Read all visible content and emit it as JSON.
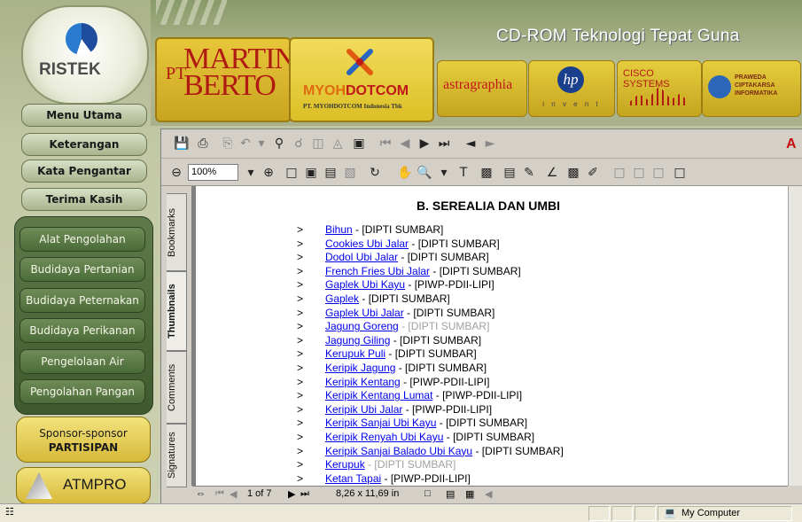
{
  "banner": {
    "title": "CD-ROM Teknologi Tepat Guna",
    "ristek": "RISTEK",
    "logos": {
      "martina_pt": "PT",
      "martina_name": "MARTINA BERTO",
      "myoh_brand_a": "MYOH",
      "myoh_brand_b": "DOTCOM",
      "myoh_sub": "PT. MYOHDOTCOM Indonesia Tbk",
      "astra": "astragraphia",
      "hp_mark": "hp",
      "hp_sub": "i n v e n t",
      "cisco": "CISCO SYSTEMS",
      "praweda": "PRAWEDA CIPTAKARSA INFORMATIKA"
    }
  },
  "nav_top": [
    "Menu Utama",
    "Keterangan",
    "Kata Pengantar",
    "Terima Kasih"
  ],
  "nav_main": [
    "Alat Pengolahan",
    "Budidaya Pertanian",
    "Budidaya Peternakan",
    "Budidaya Perikanan",
    "Pengelolaan Air",
    "Pengolahan Pangan"
  ],
  "sponsor": {
    "line1": "Sponsor-sponsor",
    "line2": "PARTISIPAN"
  },
  "atmpro": "ATMPRO",
  "viewer": {
    "zoom": "100%",
    "tabs": [
      "Bookmarks",
      "Thumbnails",
      "Comments",
      "Signatures"
    ],
    "active_tab": "Thumbnails",
    "page_indicator": "1 of 7",
    "page_size": "8,26 x 11,69 in"
  },
  "document": {
    "heading": "B.   SEREALIA DAN UMBI",
    "items": [
      {
        "title": "Bihun",
        "source": " - [DIPTI SUMBAR]",
        "grey": false
      },
      {
        "title": "Cookies Ubi Jalar",
        "source": " - [DIPTI SUMBAR]",
        "grey": false
      },
      {
        "title": "Dodol Ubi Jalar",
        "source": " - [DIPTI SUMBAR]",
        "grey": false
      },
      {
        "title": "French Fries Ubi Jalar",
        "source": " - [DIPTI SUMBAR]",
        "grey": false
      },
      {
        "title": "Gaplek Ubi Kayu",
        "source": " - [PIWP-PDII-LIPI]",
        "grey": false
      },
      {
        "title": "Gaplek",
        "source": " - [DIPTI SUMBAR]",
        "grey": false
      },
      {
        "title": "Gaplek Ubi Jalar",
        "source": " - [DIPTI SUMBAR]",
        "grey": false
      },
      {
        "title": "Jagung Goreng",
        "source": " - [DIPTI SUMBAR]",
        "grey": true
      },
      {
        "title": "Jagung Giling",
        "source": " - [DIPTI SUMBAR]",
        "grey": false
      },
      {
        "title": "Kerupuk Puli",
        "source": " - [DIPTI SUMBAR]",
        "grey": false
      },
      {
        "title": "Keripik Jagung",
        "source": " - [DIPTI SUMBAR]",
        "grey": false
      },
      {
        "title": "Keripik Kentang",
        "source": " - [PIWP-PDII-LIPI]",
        "grey": false
      },
      {
        "title": "Keripik Kentang Lumat",
        "source": " - [PIWP-PDII-LIPI]",
        "grey": false
      },
      {
        "title": "Keripik Ubi Jalar",
        "source": " - [PIWP-PDII-LIPI]",
        "grey": false
      },
      {
        "title": "Keripik Sanjai Ubi Kayu",
        "source": " - [DIPTI SUMBAR]",
        "grey": false
      },
      {
        "title": "Keripik Renyah Ubi Kayu",
        "source": " - [DIPTI SUMBAR]",
        "grey": false
      },
      {
        "title": "Keripik Sanjai Balado Ubi Kayu",
        "source": " - [DIPTI SUMBAR]",
        "grey": false
      },
      {
        "title": "Kerupuk",
        "source": " - [DIPTI SUMBAR]",
        "grey": true
      },
      {
        "title": "Ketan Tapai",
        "source": " - [PIWP-PDII-LIPI]",
        "grey": false
      }
    ],
    "bullet": ">"
  },
  "statusbar": {
    "zone": "My Computer"
  },
  "colors": {
    "link": "#0000ee",
    "nav_panel": "#4a6b38",
    "banner_gold": "#dcbf26"
  }
}
